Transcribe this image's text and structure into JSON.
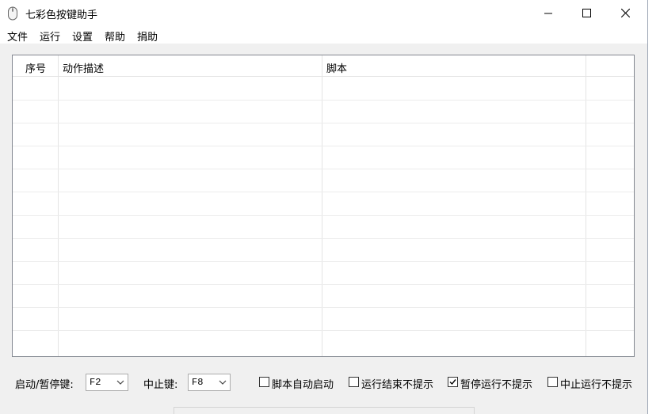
{
  "window": {
    "title": "七彩色按键助手",
    "minimize_icon": "minimize-icon",
    "maximize_icon": "maximize-icon",
    "close_icon": "close-icon",
    "app_icon": "mouse-icon"
  },
  "menu": [
    {
      "label": "文件"
    },
    {
      "label": "运行"
    },
    {
      "label": "设置"
    },
    {
      "label": "帮助"
    },
    {
      "label": "捐助"
    }
  ],
  "table": {
    "columns": [
      "序号",
      "动作描述",
      "脚本",
      ""
    ],
    "rows": []
  },
  "controls": {
    "start_pause_label": "启动/暂停键:",
    "start_pause_value": "F2",
    "stop_label": "中止键:",
    "stop_value": "F8",
    "checkboxes": [
      {
        "label": "脚本自动启动",
        "checked": false
      },
      {
        "label": "运行结束不提示",
        "checked": false
      },
      {
        "label": "暂停运行不提示",
        "checked": true
      },
      {
        "label": "中止运行不提示",
        "checked": false
      }
    ]
  }
}
